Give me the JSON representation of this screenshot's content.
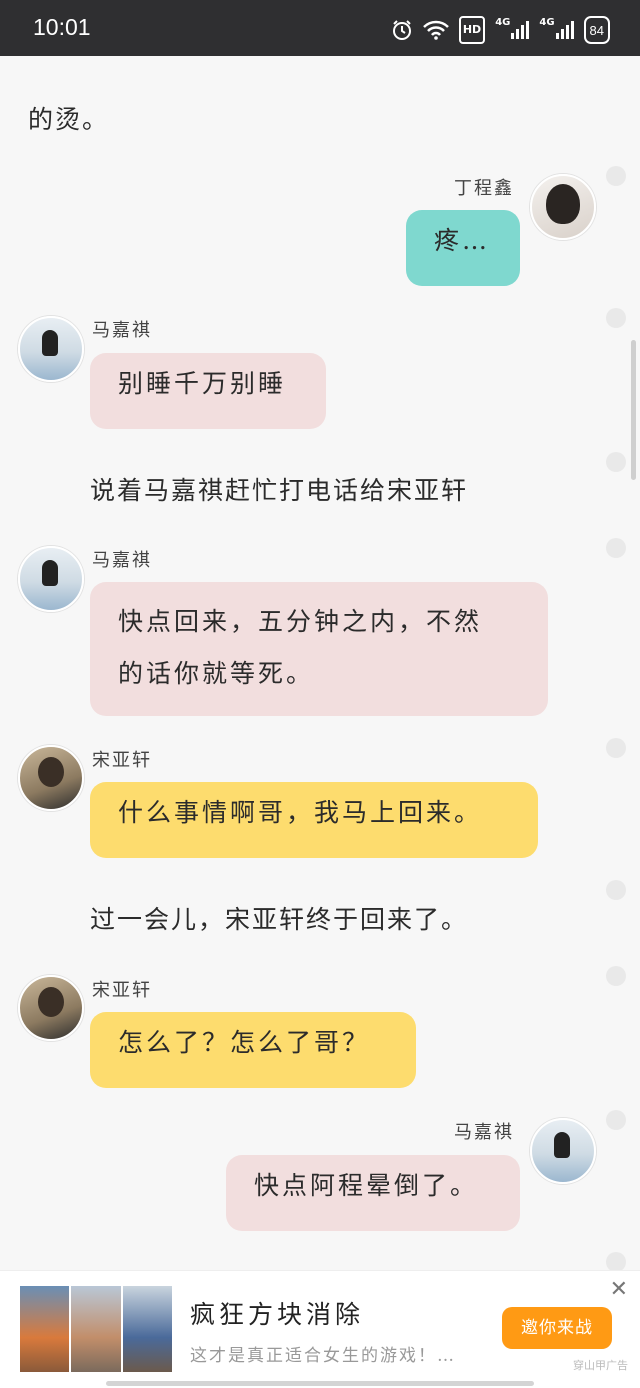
{
  "status_bar": {
    "time": "10:01",
    "hd_label": "HD",
    "network_1": "4G",
    "network_2": "4G",
    "battery": "84"
  },
  "story": {
    "top_fragment": "的烫。",
    "messages": [
      {
        "speaker": "丁程鑫",
        "text": "疼…",
        "bubble_color": "#7fd8cf",
        "side": "right"
      },
      {
        "speaker": "马嘉祺",
        "text": "别睡千万别睡",
        "bubble_color": "#f2dede",
        "side": "left"
      },
      {
        "narration": "说着马嘉祺赶忙打电话给宋亚轩"
      },
      {
        "speaker": "马嘉祺",
        "line1": "快点回来，五分钟之内，不然",
        "line2": "的话你就等死。",
        "bubble_color": "#f2dede",
        "side": "left"
      },
      {
        "speaker": "宋亚轩",
        "text": "什么事情啊哥，我马上回来。",
        "bubble_color": "#fddc6e",
        "side": "left"
      },
      {
        "narration": "过一会儿，宋亚轩终于回来了。"
      },
      {
        "speaker": "宋亚轩",
        "text": "怎么了？怎么了哥？",
        "bubble_color": "#fddc6e",
        "side": "left"
      },
      {
        "speaker": "马嘉祺",
        "text": "快点阿程晕倒了。",
        "bubble_color": "#f2dede",
        "side": "right"
      }
    ]
  },
  "ad": {
    "title": "疯狂方块消除",
    "description": "这才是真正适合女生的游戏！…",
    "cta": "邀你来战",
    "source": "穿山甲广告",
    "close_icon": "close-icon"
  }
}
